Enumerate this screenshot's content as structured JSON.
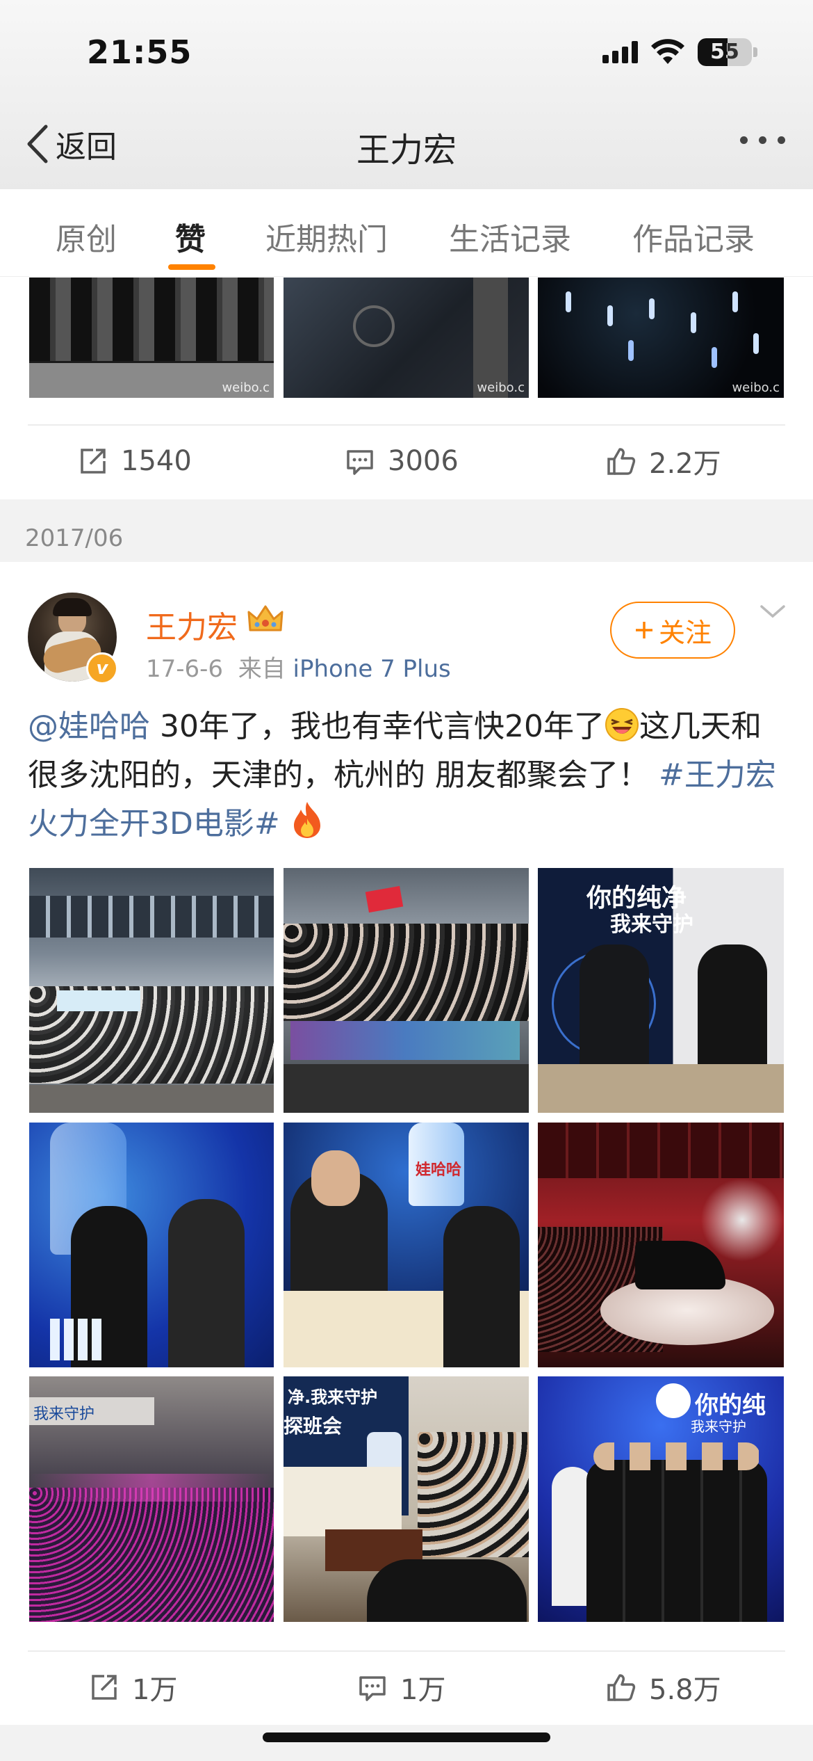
{
  "status_bar": {
    "time": "21:55",
    "battery": "55"
  },
  "nav": {
    "back_label": "返回",
    "title": "王力宏"
  },
  "tabs": [
    {
      "label": "原创",
      "active": false
    },
    {
      "label": "赞",
      "active": true
    },
    {
      "label": "近期热门",
      "active": false
    },
    {
      "label": "生活记录",
      "active": false
    },
    {
      "label": "作品记录",
      "active": false
    }
  ],
  "prev_post": {
    "watermark": "weibo.c",
    "repost_count": "1540",
    "comment_count": "3006",
    "like_count": "2.2万"
  },
  "date_groups": [
    "2017/06"
  ],
  "post": {
    "author": "王力宏",
    "time": "17-6-6",
    "source_prefix": "来自",
    "source": "iPhone 7 Plus",
    "follow_label": "关注",
    "text": {
      "mention": "@娃哈哈",
      "body_1": " 30年了，我也有幸代言快20年了",
      "body_2": "这几天和很多沈阳的，天津的，杭州的 朋友都聚会了！",
      "topic": "#王力宏火力全开3D电影#"
    },
    "image_captions": {
      "img3_title": "你的纯净",
      "img3_sub": "我来守护",
      "img5_brand": "娃哈哈",
      "img7_banner": "我来守护",
      "img8_banner": "净.我来守护",
      "img8_sub": "探班会",
      "img9_title": "你的纯",
      "img9_sub": "我来守护"
    },
    "repost_count": "1万",
    "comment_count": "1万",
    "like_count": "5.8万"
  },
  "icons": {
    "back": "chevron-left-icon",
    "more": "more-dots-icon",
    "repost": "share-arrow-icon",
    "comment": "comment-bubble-icon",
    "like": "thumbs-up-icon",
    "follow": "plus-icon",
    "chevron": "chevron-down-icon",
    "crown": "crown-icon",
    "verified": "verified-badge-icon"
  },
  "colors": {
    "accent": "#ff8200",
    "author": "#f06a1c",
    "link": "#4d6e9c"
  }
}
